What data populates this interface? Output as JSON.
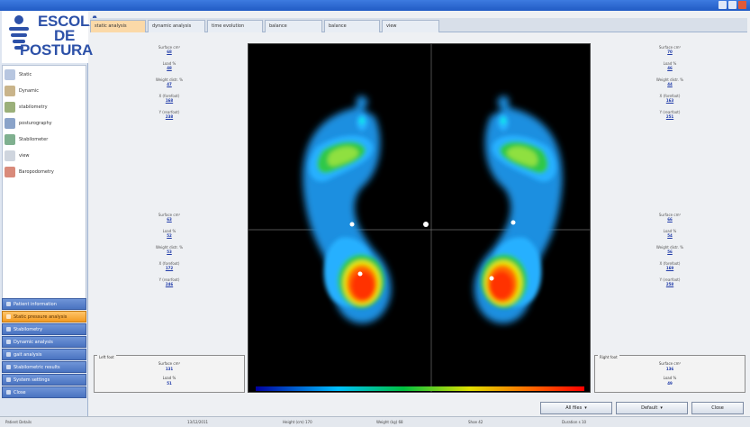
{
  "app": {
    "logo": {
      "line1": "ESCOLA",
      "line2": "DE",
      "line3": "POSTURA"
    }
  },
  "tabs": [
    {
      "label": "static analysis",
      "active": true
    },
    {
      "label": "dynamic analysis",
      "active": false
    },
    {
      "label": "time evolution",
      "active": false
    },
    {
      "label": "balance",
      "active": false
    },
    {
      "label": "balance",
      "active": false
    },
    {
      "label": "view",
      "active": false
    }
  ],
  "sidebar": {
    "tools": [
      {
        "label": "Static",
        "icon": "foot-icon"
      },
      {
        "label": "Dynamic",
        "icon": "foot-print-icon"
      },
      {
        "label": "stabilometry",
        "icon": "person-icon"
      },
      {
        "label": "posturography",
        "icon": "walking-icon"
      },
      {
        "label": "Stabilometer",
        "icon": "balance-icon"
      },
      {
        "label": "view",
        "icon": "document-icon"
      },
      {
        "label": "Baropodometry",
        "icon": "chart-icon"
      }
    ],
    "nav": [
      {
        "label": "Patient information",
        "active": false
      },
      {
        "label": "Static pressure analysis",
        "active": true
      },
      {
        "label": "Stabilometry",
        "active": false
      },
      {
        "label": "Dynamic analysis",
        "active": false
      },
      {
        "label": "gait analysis",
        "active": false
      },
      {
        "label": "Stabilometric results",
        "active": false
      },
      {
        "label": "System settings",
        "active": false
      },
      {
        "label": "Close",
        "active": false
      }
    ]
  },
  "left_stats_top": [
    {
      "label": "Surface cm²",
      "value": "68"
    },
    {
      "label": "Load %",
      "value": "48"
    },
    {
      "label": "Weight distr. %",
      "value": "47"
    },
    {
      "label": "X (forefoot)",
      "value": "168"
    },
    {
      "label": "Y (rearfoot)",
      "value": "238"
    }
  ],
  "left_stats_bottom": [
    {
      "label": "Surface cm²",
      "value": "63"
    },
    {
      "label": "Load %",
      "value": "52"
    },
    {
      "label": "Weight distr. %",
      "value": "53"
    },
    {
      "label": "X (forefoot)",
      "value": "172"
    },
    {
      "label": "Y (rearfoot)",
      "value": "246"
    }
  ],
  "right_stats_top": [
    {
      "label": "Surface cm²",
      "value": "70"
    },
    {
      "label": "Load %",
      "value": "46"
    },
    {
      "label": "Weight distr. %",
      "value": "44"
    },
    {
      "label": "X (forefoot)",
      "value": "163"
    },
    {
      "label": "Y (rearfoot)",
      "value": "251"
    }
  ],
  "right_stats_bottom": [
    {
      "label": "Surface cm²",
      "value": "66"
    },
    {
      "label": "Load %",
      "value": "54"
    },
    {
      "label": "Weight distr. %",
      "value": "56"
    },
    {
      "label": "X (forefoot)",
      "value": "169"
    },
    {
      "label": "Y (rearfoot)",
      "value": "258"
    }
  ],
  "left_box": {
    "title": "Left foot",
    "line1": "Surface cm²",
    "val1": "131",
    "line2": "Load %",
    "val2": "51"
  },
  "right_box": {
    "title": "Right foot",
    "line1": "Surface cm²",
    "val1": "136",
    "line2": "Load %",
    "val2": "49"
  },
  "buttons": {
    "b1": "All files",
    "b2": "Default",
    "b3": "Close"
  },
  "status": {
    "s1": "Patient Details",
    "s2": "13/12/2011",
    "s3": "Height (cm) 170",
    "s4": "Weight (kg) 68",
    "s5": "Shoe 42",
    "s6": "Duration s 10"
  },
  "colors": {
    "accent": "#f29a22",
    "nav": "#4a73c0",
    "brand": "#2d51a8"
  }
}
